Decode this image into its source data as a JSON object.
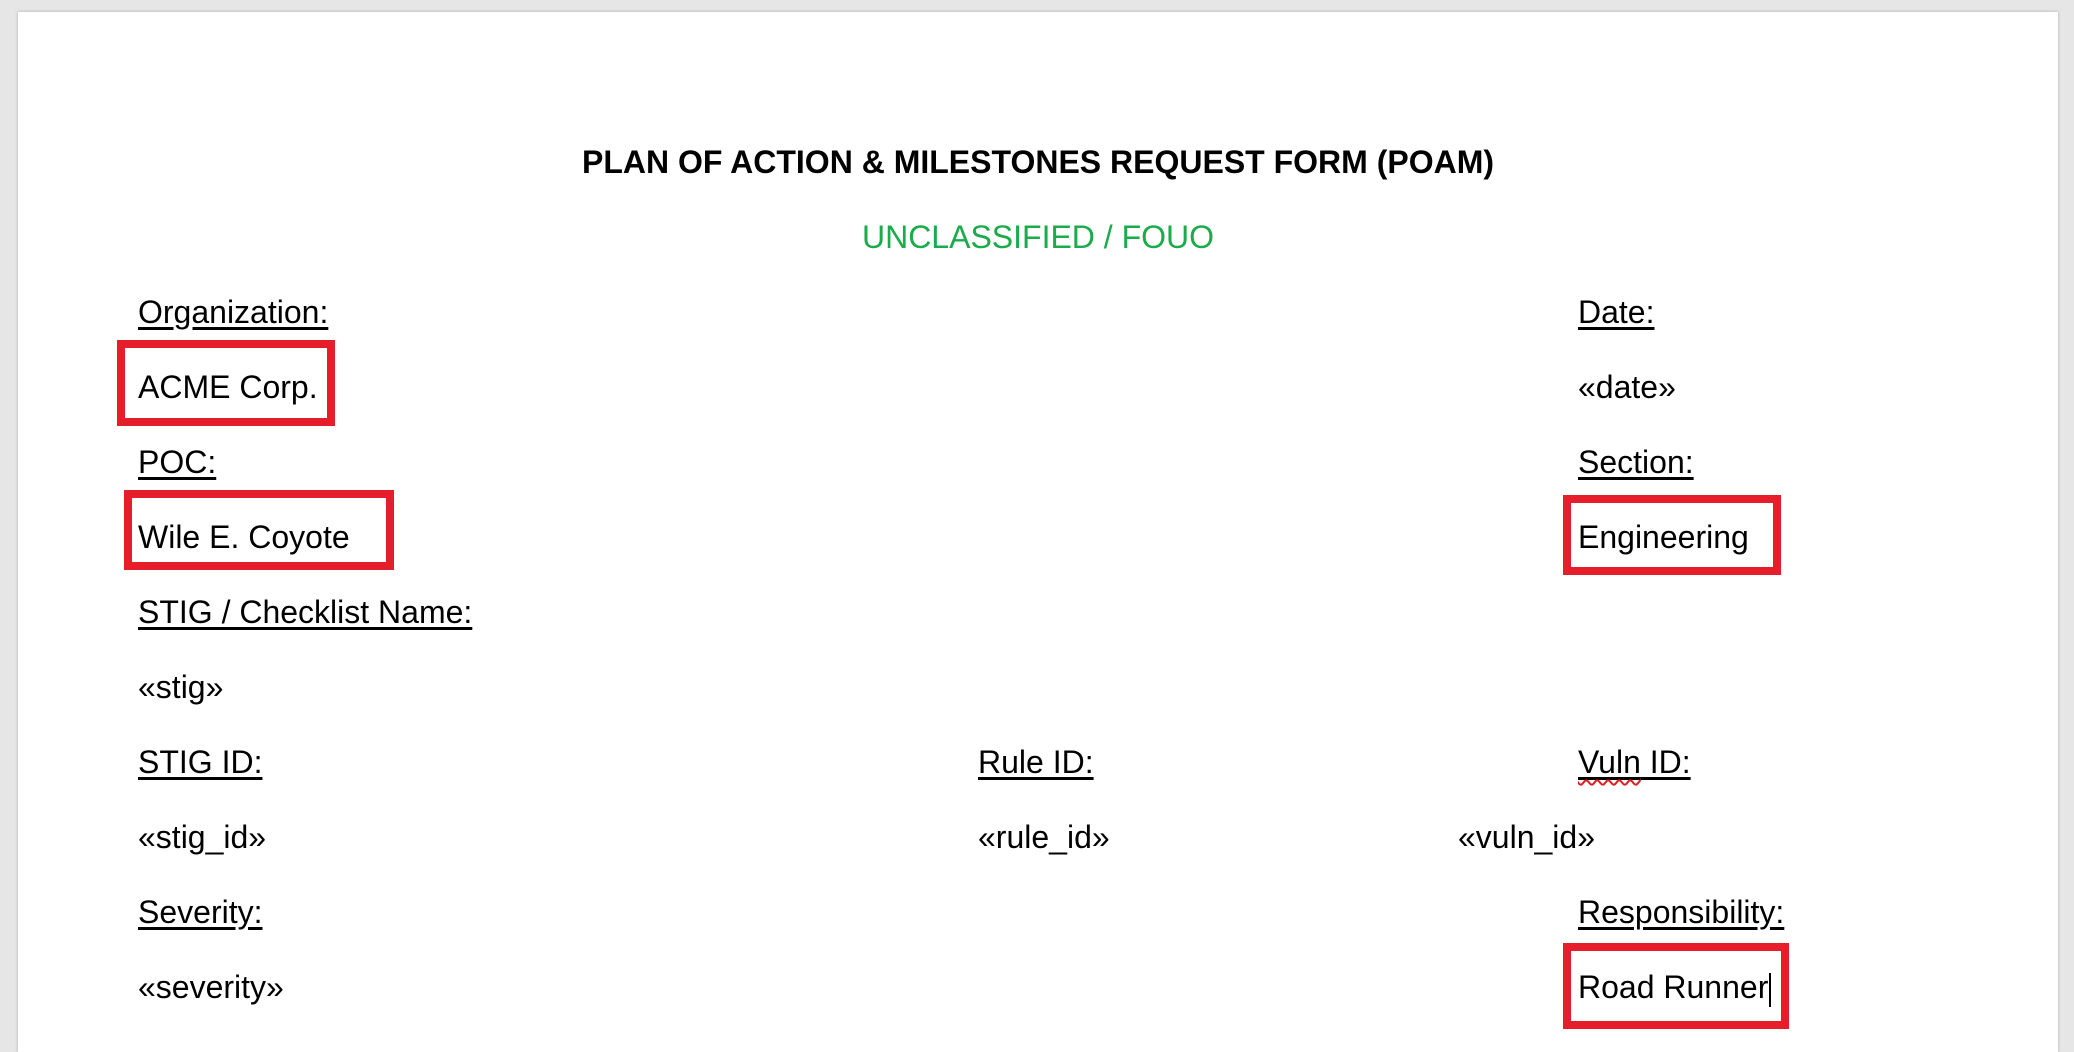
{
  "form": {
    "title": "PLAN OF ACTION & MILESTONES REQUEST FORM (POAM)",
    "classification": "UNCLASSIFIED / FOUO",
    "classification_color": "#1aab4a",
    "highlight_color": "#e61e2b"
  },
  "fields": {
    "organization": {
      "label": "Organization:",
      "value": "ACME Corp."
    },
    "date": {
      "label": "Date:",
      "value": "«date»"
    },
    "poc": {
      "label": "POC:",
      "value": "Wile E. Coyote"
    },
    "section": {
      "label": "Section:",
      "value": "Engineering"
    },
    "stig_name": {
      "label": "STIG / Checklist Name:",
      "value": "«stig»"
    },
    "stig_id": {
      "label": "STIG ID:",
      "value": "«stig_id»"
    },
    "rule_id": {
      "label": "Rule ID:",
      "value": "«rule_id»"
    },
    "vuln_id": {
      "label_part1": "Vuln",
      "label_part2": " ID:",
      "value": "«vuln_id»"
    },
    "severity": {
      "label": "Severity:",
      "value": "«severity»"
    },
    "responsibility": {
      "label": "Responsibility:",
      "value": "Road Runner"
    }
  }
}
